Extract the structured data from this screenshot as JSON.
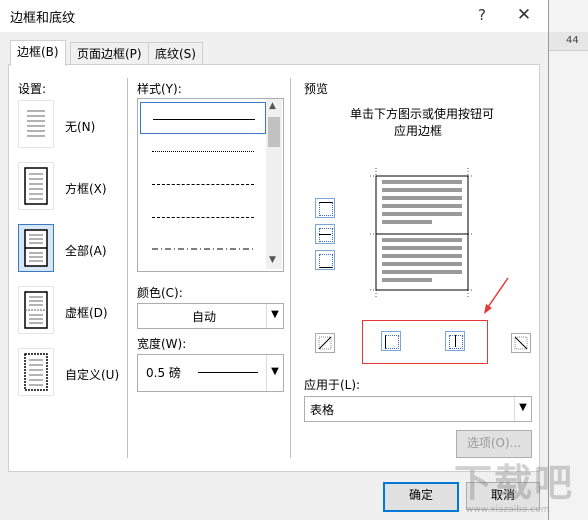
{
  "window": {
    "title": "边框和底纹",
    "help": "?",
    "close": "✕"
  },
  "background": {
    "ruler_number": "44"
  },
  "tabs": [
    {
      "label": "边框(B)"
    },
    {
      "label": "页面边框(P)"
    },
    {
      "label": "底纹(S)"
    }
  ],
  "settings": {
    "heading": "设置:",
    "items": [
      {
        "label": "无(N)"
      },
      {
        "label": "方框(X)"
      },
      {
        "label": "全部(A)"
      },
      {
        "label": "虚框(D)"
      },
      {
        "label": "自定义(U)"
      }
    ]
  },
  "style": {
    "heading": "样式(Y):",
    "options": [
      "solid",
      "dotted",
      "dashed-small",
      "dashed",
      "dash-dot"
    ]
  },
  "color": {
    "heading": "颜色(C):",
    "value": "自动"
  },
  "width": {
    "heading": "宽度(W):",
    "value": "0.5 磅"
  },
  "preview": {
    "heading": "预览",
    "hint_line1": "单击下方图示或使用按钮可",
    "hint_line2": "应用边框"
  },
  "apply_to": {
    "heading": "应用于(L):",
    "value": "表格"
  },
  "buttons": {
    "options": "选项(O)...",
    "ok": "确定",
    "cancel": "取消"
  },
  "watermark": {
    "text": "下载吧",
    "url": "www.xiazaiba.com"
  },
  "colors": {
    "accent": "#0078d7",
    "highlight": "#e53935",
    "selection": "#d7e7f8"
  }
}
